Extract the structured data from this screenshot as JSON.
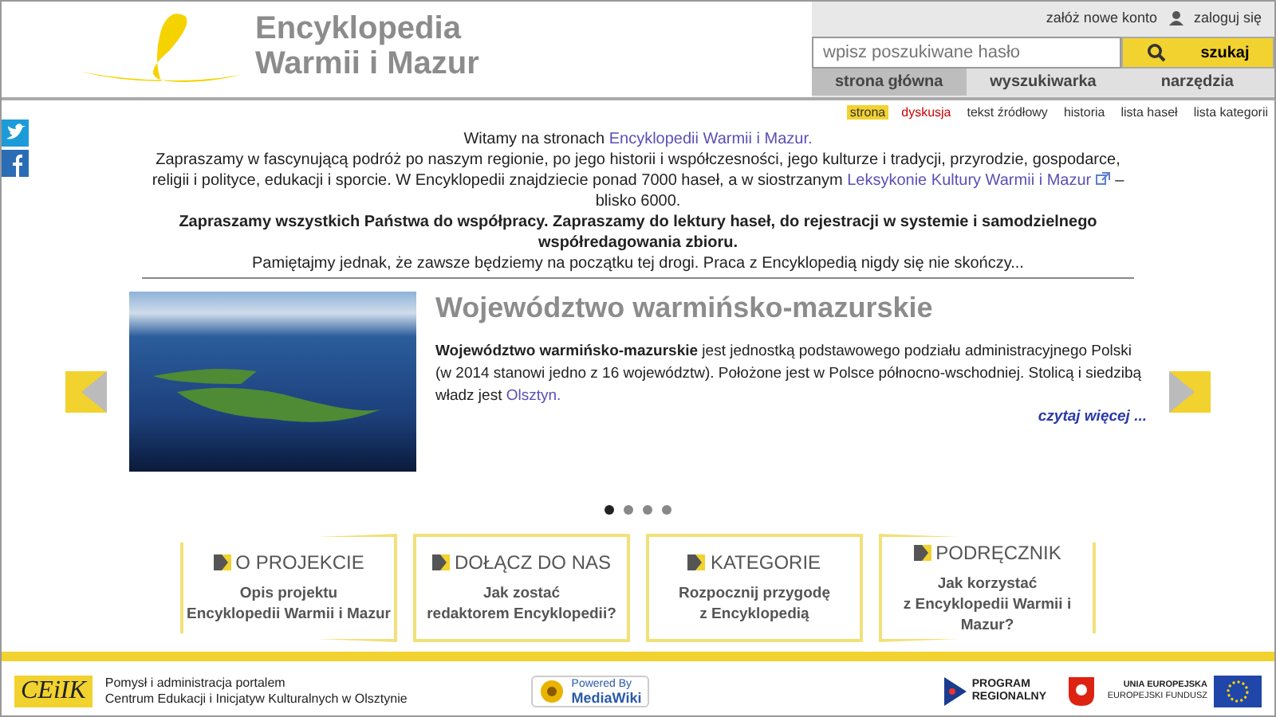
{
  "logo": {
    "line_1": "Encyklopedia",
    "line_2": "Warmii i Mazur"
  },
  "account_links": [
    {
      "label": "załóż nowe konto",
      "kind": "text"
    },
    {
      "label": "zaloguj się",
      "kind": "user"
    }
  ],
  "search": {
    "placeholder": "wpisz poszukiwane hasło",
    "button": "szukaj"
  },
  "nav_tabs": [
    {
      "label": "strona główna",
      "selected": true
    },
    {
      "label": "wyszukiwarka",
      "selected": false
    },
    {
      "label": "narzędzia",
      "selected": false
    }
  ],
  "page_tabs": [
    {
      "label": "strona",
      "selected": true,
      "kind": "normal"
    },
    {
      "label": "dyskusja",
      "selected": false,
      "kind": "missing"
    },
    {
      "label": "tekst źródłowy",
      "selected": false,
      "kind": "normal"
    },
    {
      "label": "historia",
      "selected": false,
      "kind": "normal"
    },
    {
      "label": "lista haseł",
      "selected": false,
      "kind": "normal"
    },
    {
      "label": "lista kategorii",
      "selected": false,
      "kind": "normal"
    }
  ],
  "intro": {
    "greeting": "Witamy na stronach",
    "greeting_link": "Encyklopedii Warmii i Mazur.",
    "body_start": "Zapraszamy w fascynującą podróż po naszym regionie, po jego historii i współczesności, jego kulturze i tradycji, przyrodzie, gospodarce, religii i polityce, edukacji i sporcie. W Encyklopedii znajdziecie ponad 7000 haseł, a w siostrzanym",
    "body_link": "Leksykonie Kultury Warmii i Mazur",
    "body_end": "– blisko 6000.",
    "bold_line": "Zapraszamy wszystkich Państwa do współpracy. Zapraszamy do lektury haseł, do rejestracji w systemie i samodzielnego współredagowania zbioru.",
    "closing": "Pamiętajmy jednak, że zawsze będziemy na początku tej drogi. Praca z Encyklopedią nigdy się nie skończy..."
  },
  "slide": {
    "title": "Województwo warmińsko-mazurskie",
    "text": "**Województwo warmińsko-mazurskie** jest jednostką podstawowego podziału administracyjnego Polski (w 2014 stanowi jedno z 16 województw). Położone jest w Polsce północno-wschodniej. Stolicą i siedzibą władz jest",
    "link": "Olsztyn.",
    "more": "czytaj więcej ..."
  },
  "slide_dots": [
    {
      "selected": true
    },
    {
      "selected": false
    },
    {
      "selected": false
    },
    {
      "selected": false
    }
  ],
  "cards": [
    {
      "title": "O PROJEKCIE",
      "lines": [
        "Opis projektu",
        "Encyklopedii Warmii i Mazur"
      ],
      "kind": "left"
    },
    {
      "title": "DOŁĄCZ DO NAS",
      "lines": [
        "Jak zostać",
        "redaktorem Encyklopedii?"
      ],
      "kind": "flat"
    },
    {
      "title": "KATEGORIE",
      "lines": [
        "Rozpocznij przygodę",
        "z Encyklopedią"
      ],
      "kind": "flat"
    },
    {
      "title": "PODRĘCZNIK",
      "lines": [
        "Jak korzystać",
        "z Encyklopedii Warmii i Mazur?"
      ],
      "kind": "right"
    }
  ],
  "footer": {
    "logo": "CEiIK",
    "text_1": "Pomysł i administracja portalem",
    "text_2": "Centrum Edukacji i Inicjatyw Kulturalnych w Olsztynie",
    "powered_1": "Powered By",
    "powered_2": "MediaWiki",
    "program": "PROGRAM REGIONALNY",
    "eu_1": "UNIA EUROPEJSKA",
    "eu_2": "EUROPEJSKI FUNDUSZ"
  }
}
